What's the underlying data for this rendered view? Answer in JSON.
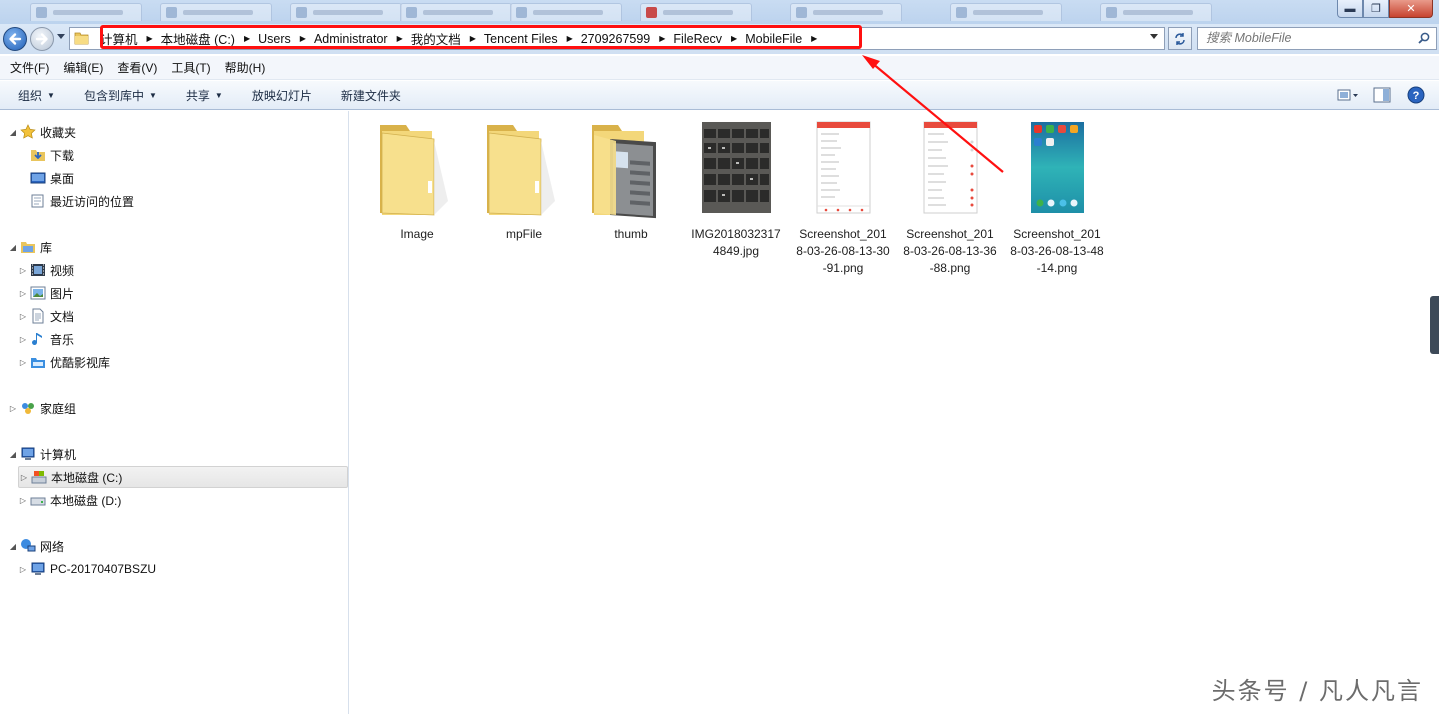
{
  "window": {
    "minimize_glyph": "▬",
    "maximize_glyph": "❐",
    "close_glyph": "✕"
  },
  "address": {
    "crumbs": [
      "计算机",
      "本地磁盘 (C:)",
      "Users",
      "Administrator",
      "我的文档",
      "Tencent Files",
      "2709267599",
      "FileRecv",
      "MobileFile"
    ],
    "search_placeholder": "搜索 MobileFile"
  },
  "menubar": [
    "文件(F)",
    "编辑(E)",
    "查看(V)",
    "工具(T)",
    "帮助(H)"
  ],
  "commands": [
    "组织",
    "包含到库中",
    "共享",
    "放映幻灯片",
    "新建文件夹"
  ],
  "navigation": {
    "favorites": {
      "label": "收藏夹",
      "items": [
        "下载",
        "桌面",
        "最近访问的位置"
      ]
    },
    "libraries": {
      "label": "库",
      "items": [
        "视频",
        "图片",
        "文档",
        "音乐",
        "优酷影视库"
      ]
    },
    "homegroup": {
      "label": "家庭组"
    },
    "computer": {
      "label": "计算机",
      "items": [
        "本地磁盘 (C:)",
        "本地磁盘 (D:)"
      ]
    },
    "network": {
      "label": "网络",
      "items": [
        "PC-20170407BSZU"
      ]
    }
  },
  "files": [
    {
      "name": "Image",
      "kind": "folder"
    },
    {
      "name": "mpFile",
      "kind": "folder"
    },
    {
      "name": "thumb",
      "kind": "folder-with-preview"
    },
    {
      "name": "IMG20180323174849.jpg",
      "kind": "photo-keyboard"
    },
    {
      "name": "Screenshot_2018-03-26-08-13-30-91.png",
      "kind": "screenshot-list"
    },
    {
      "name": "Screenshot_2018-03-26-08-13-36-88.png",
      "kind": "screenshot-settings"
    },
    {
      "name": "Screenshot_2018-03-26-08-13-48-14.png",
      "kind": "screenshot-home"
    }
  ],
  "watermark": "头条号 / 凡人凡言",
  "colors": {
    "highlight": "#ff1010",
    "accent": "#1f5fb7"
  }
}
